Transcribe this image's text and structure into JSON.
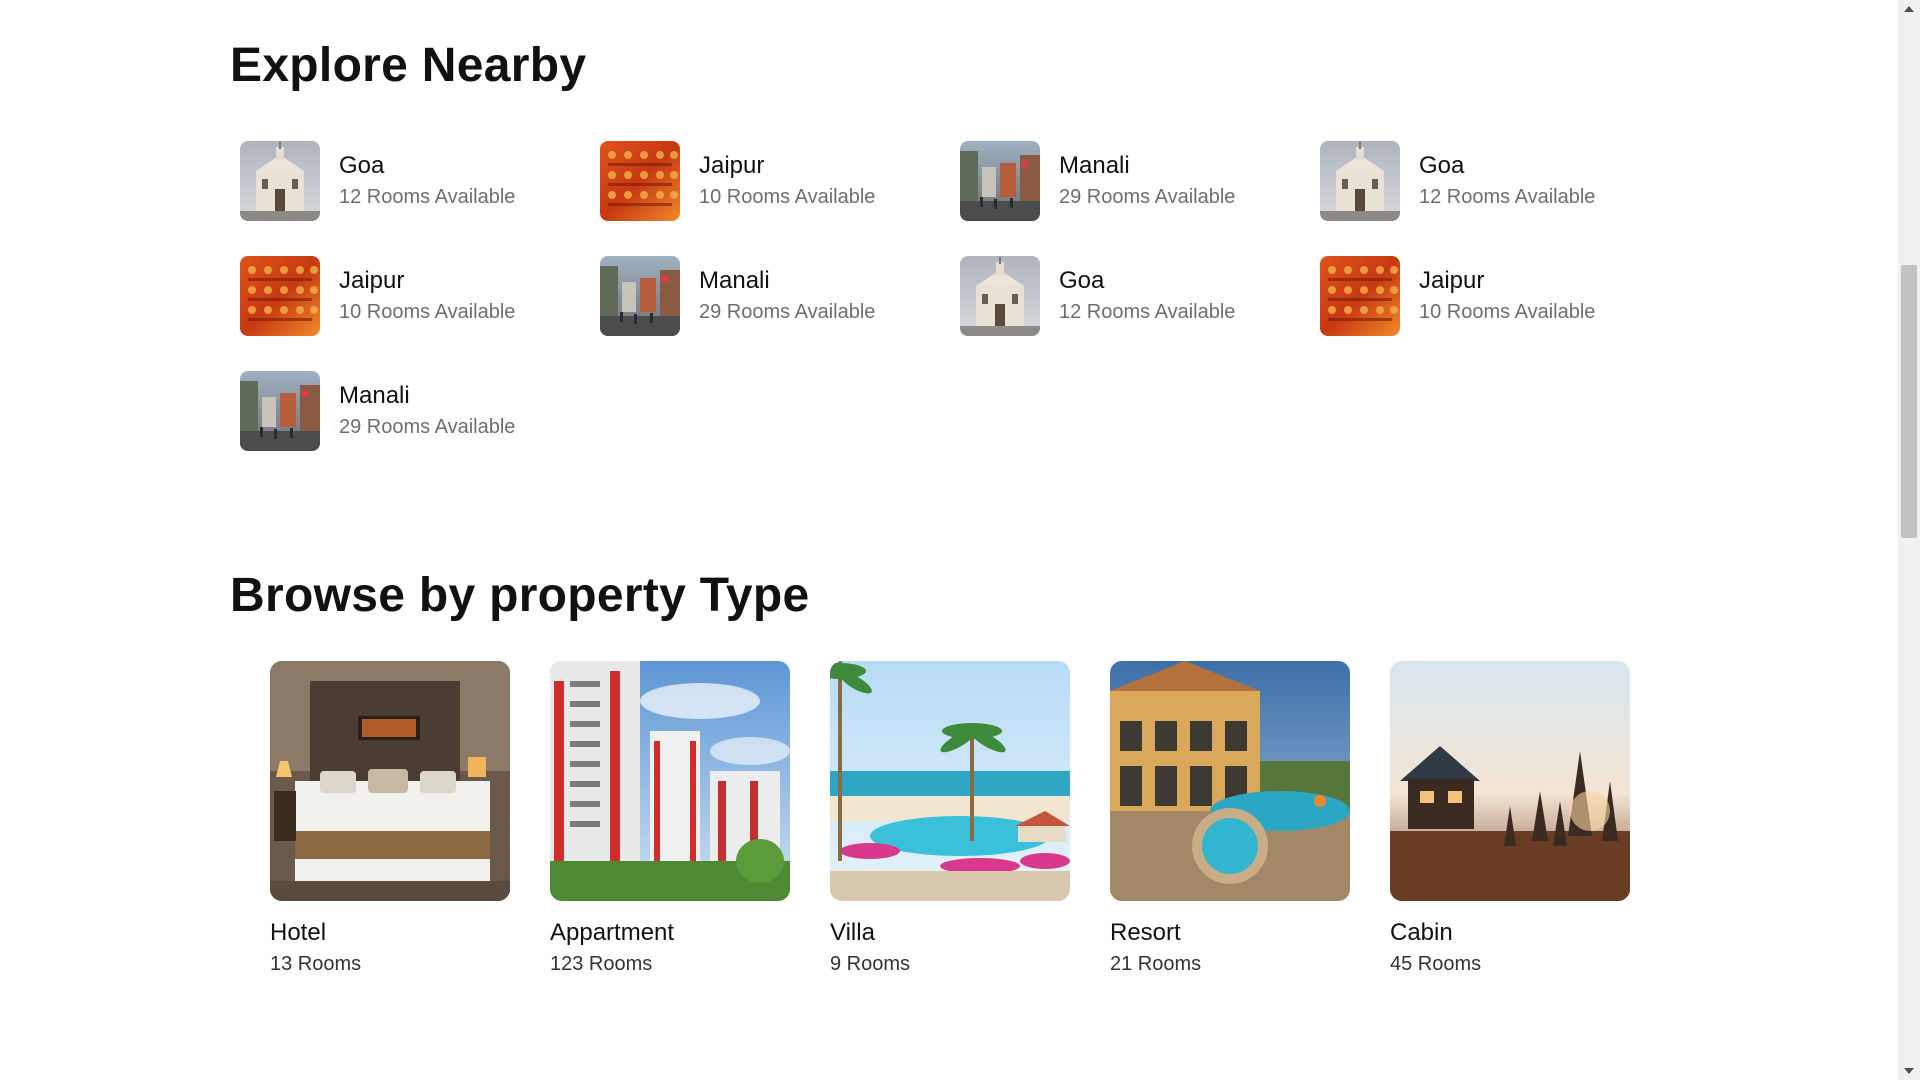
{
  "explore": {
    "title": "Explore Nearby",
    "items": [
      {
        "city": "Goa",
        "rooms": "12 Rooms Available",
        "thumb": "goa"
      },
      {
        "city": "Jaipur",
        "rooms": "10 Rooms Available",
        "thumb": "jaipur"
      },
      {
        "city": "Manali",
        "rooms": "29 Rooms Available",
        "thumb": "manali"
      },
      {
        "city": "Goa",
        "rooms": "12 Rooms Available",
        "thumb": "goa"
      },
      {
        "city": "Jaipur",
        "rooms": "10 Rooms Available",
        "thumb": "jaipur"
      },
      {
        "city": "Manali",
        "rooms": "29 Rooms Available",
        "thumb": "manali"
      },
      {
        "city": "Goa",
        "rooms": "12 Rooms Available",
        "thumb": "goa"
      },
      {
        "city": "Jaipur",
        "rooms": "10 Rooms Available",
        "thumb": "jaipur"
      },
      {
        "city": "Manali",
        "rooms": "29 Rooms Available",
        "thumb": "manali"
      }
    ]
  },
  "browse": {
    "title": "Browse by property Type",
    "items": [
      {
        "name": "Hotel",
        "rooms": "13 Rooms",
        "image": "hotel"
      },
      {
        "name": "Appartment",
        "rooms": "123 Rooms",
        "image": "apartment"
      },
      {
        "name": "Villa",
        "rooms": "9 Rooms",
        "image": "villa"
      },
      {
        "name": "Resort",
        "rooms": "21 Rooms",
        "image": "resort"
      },
      {
        "name": "Cabin",
        "rooms": "45 Rooms",
        "image": "cabin"
      }
    ]
  },
  "colors": {
    "heading": "#111111",
    "subtext": "#6e6e6e",
    "background": "#ffffff"
  }
}
